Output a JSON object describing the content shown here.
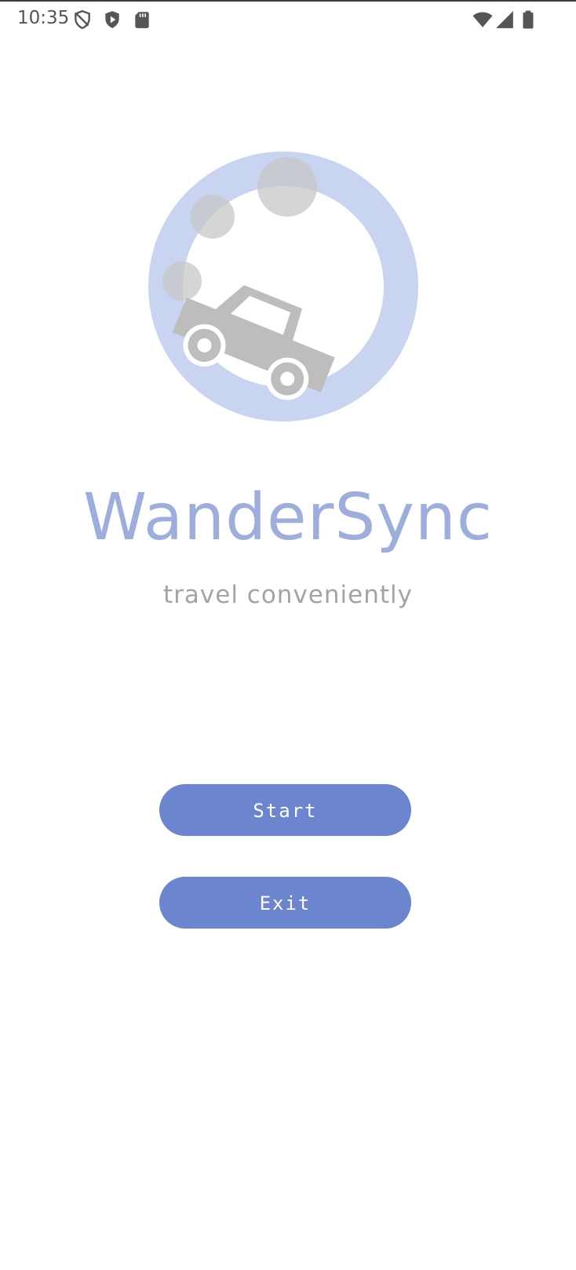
{
  "status_bar": {
    "time": "10:35",
    "left_icons": [
      "vpn-shield-icon",
      "play-protect-icon",
      "sd-card-icon"
    ],
    "right_icons": [
      "wifi-icon",
      "cellular-signal-icon",
      "battery-icon"
    ]
  },
  "app": {
    "title": "WanderSync",
    "tagline": "travel conveniently",
    "logo_icon": "car-ring-logo-icon"
  },
  "buttons": {
    "start_label": "Start",
    "exit_label": "Exit"
  },
  "colors": {
    "accent": "#6b85cf",
    "title": "#9eaedc",
    "ring": "#c9d4f0",
    "car": "#bdbdbd",
    "tagline": "#a3a3a3"
  }
}
